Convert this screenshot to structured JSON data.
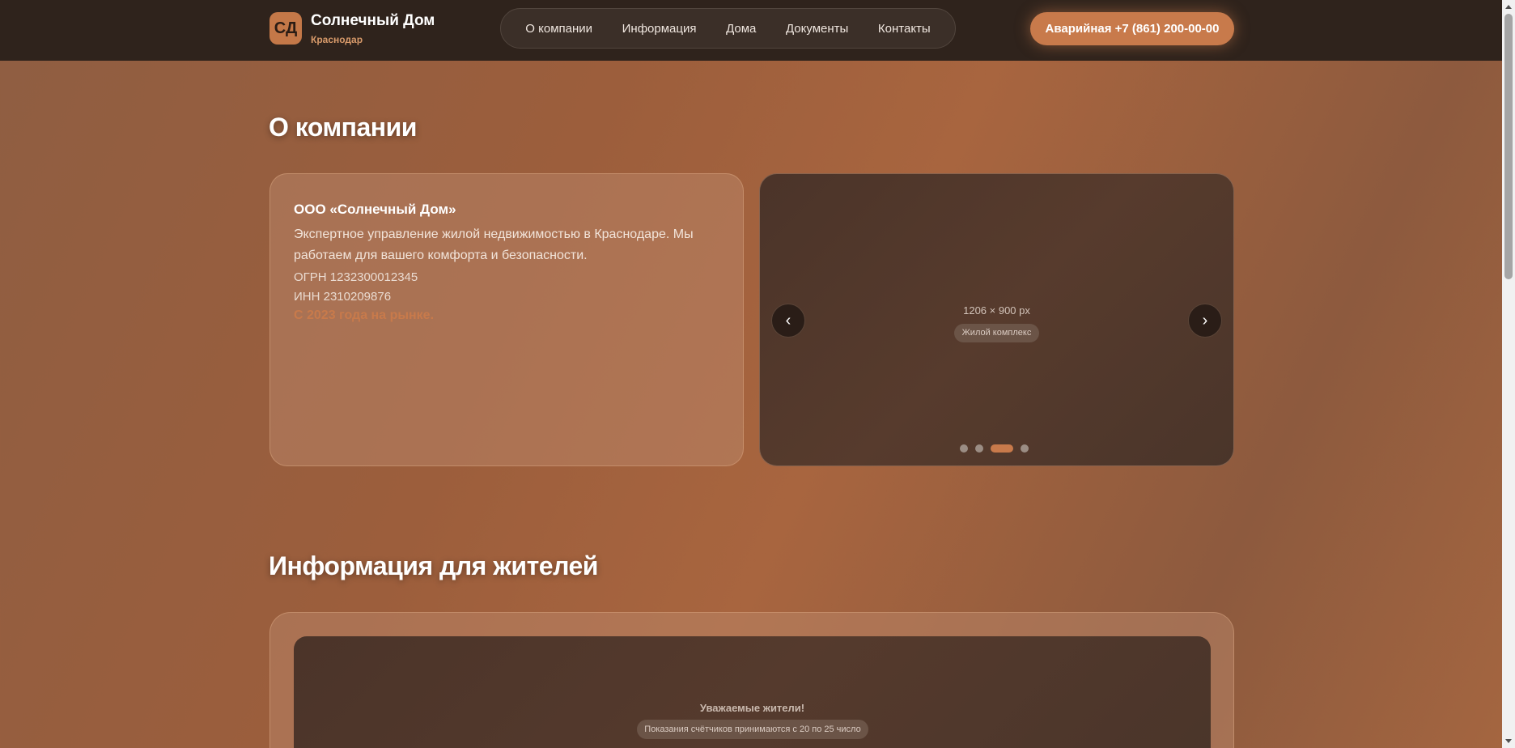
{
  "header": {
    "logo_text": "СД",
    "brand_name": "Солнечный Дом",
    "city": "Краснодар",
    "nav": [
      "О компании",
      "Информация",
      "Дома",
      "Документы",
      "Контакты"
    ],
    "emergency_label": "Аварийная +7 (861) 200-00-00"
  },
  "about": {
    "title": "О компании",
    "company_name": "ООО «Солнечный Дом»",
    "description": "Экспертное управление жилой недвижимостью в Краснодаре. Мы работаем для вашего комфорта и безопасности.",
    "ogrn": "ОГРН 1232300012345",
    "inn": "ИНН 2310209876",
    "since": "С 2023 года на рынке."
  },
  "slider": {
    "size_label": "1206 × 900 px",
    "tag": "Жилой комплекс",
    "prev": "‹",
    "next": "›",
    "dot_count": 4,
    "active_dot": 3
  },
  "info": {
    "title": "Информация для жителей",
    "notice_title": "Уважаемые жители!",
    "notice_text": "Показания счётчиков принимаются с 20 по 25 число"
  },
  "colors": {
    "accent": "#c87a4b",
    "header_bg": "#2f231c"
  }
}
